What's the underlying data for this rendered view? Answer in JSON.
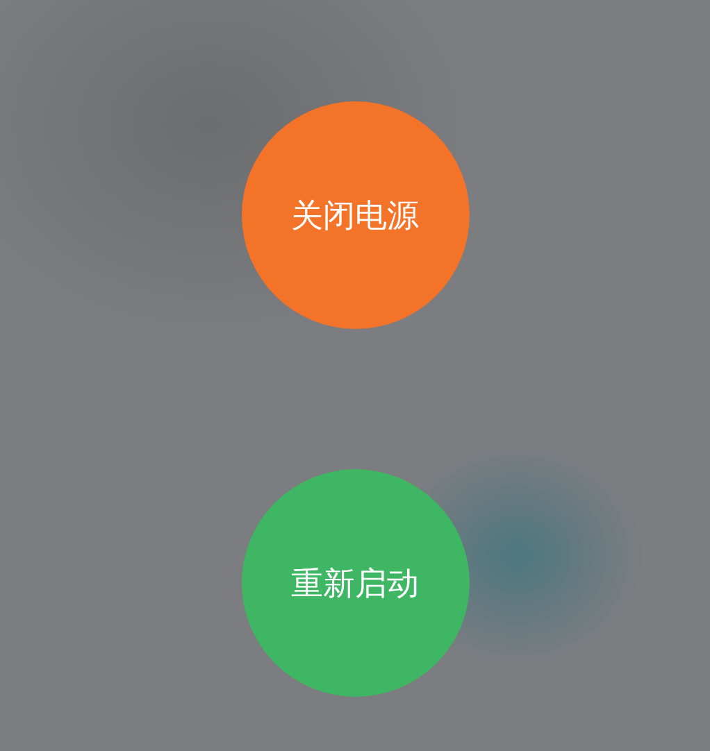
{
  "buttons": [
    {
      "label": "关闭电源",
      "kind": "power_off"
    },
    {
      "label": "重新启动",
      "kind": "restart"
    }
  ]
}
